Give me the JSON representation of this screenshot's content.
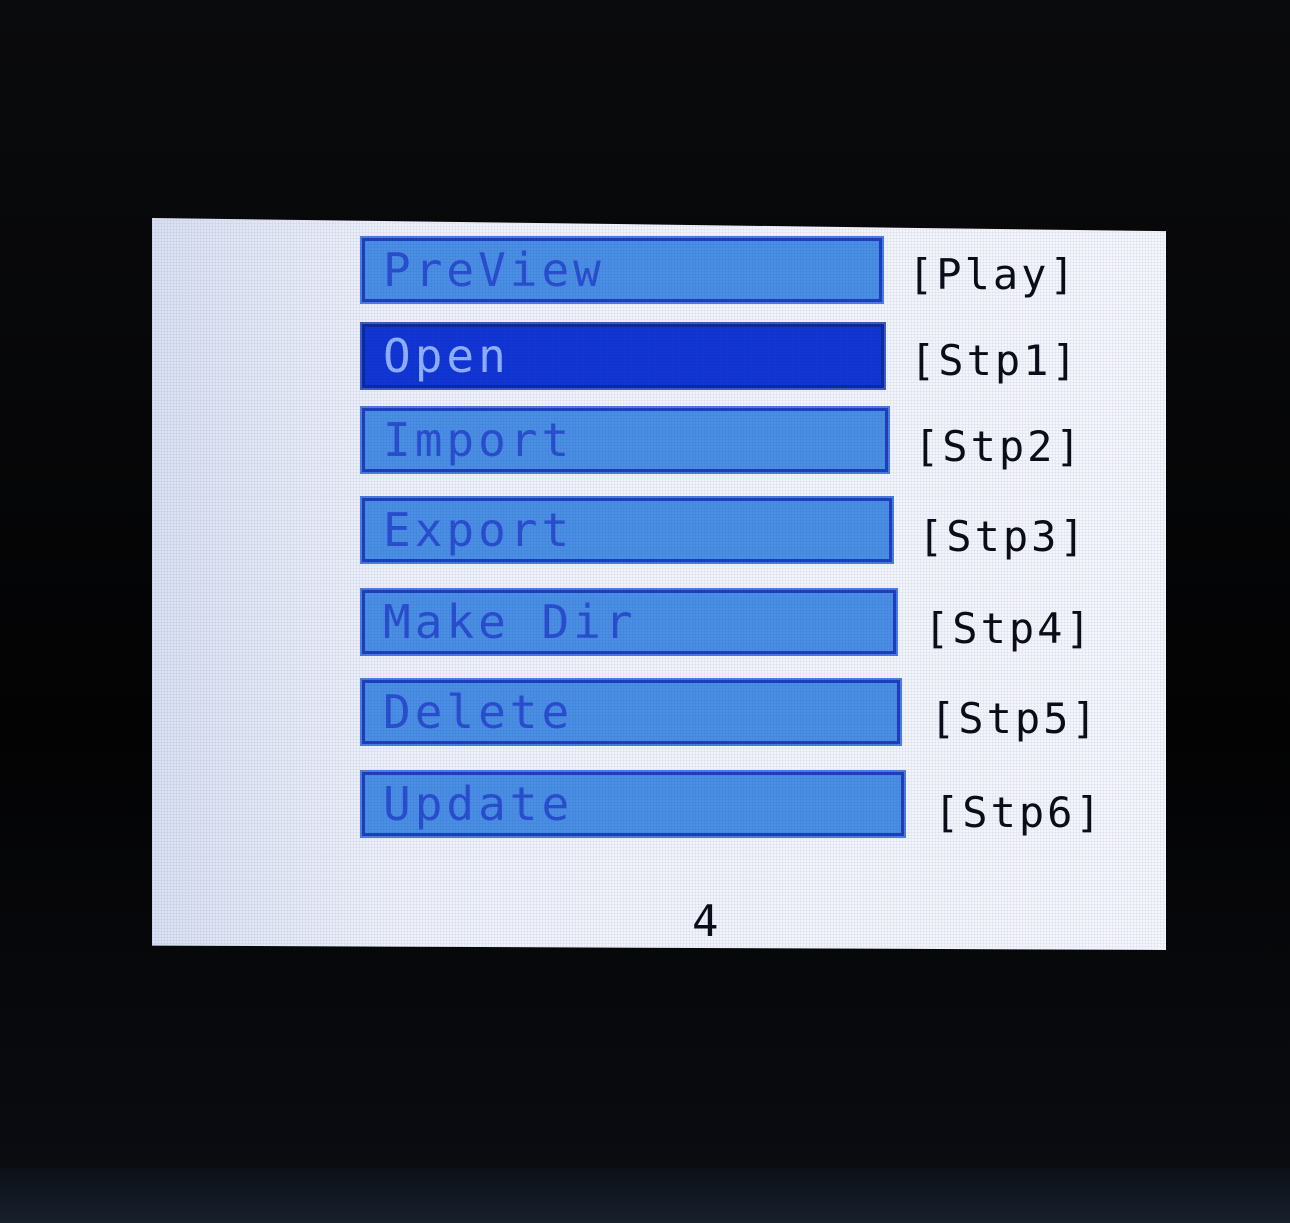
{
  "menu": {
    "items": [
      {
        "label": "PreView",
        "shortcut": "[Play]",
        "selected": false
      },
      {
        "label": "Open",
        "shortcut": "[Stp1]",
        "selected": true
      },
      {
        "label": "Import",
        "shortcut": "[Stp2]",
        "selected": false
      },
      {
        "label": "Export",
        "shortcut": "[Stp3]",
        "selected": false
      },
      {
        "label": "Make Dir",
        "shortcut": "[Stp4]",
        "selected": false
      },
      {
        "label": "Delete",
        "shortcut": "[Stp5]",
        "selected": false
      },
      {
        "label": "Update",
        "shortcut": "[Stp6]",
        "selected": false
      }
    ]
  },
  "footer": {
    "page_number": "4"
  },
  "colors": {
    "item_fill": "#4a8fe6",
    "item_text": "#2a4fd0",
    "selected_fill": "#1235d6",
    "selected_text": "#8fb2ff",
    "screen_background": "#f4f6fd",
    "bezel": "#050608"
  }
}
